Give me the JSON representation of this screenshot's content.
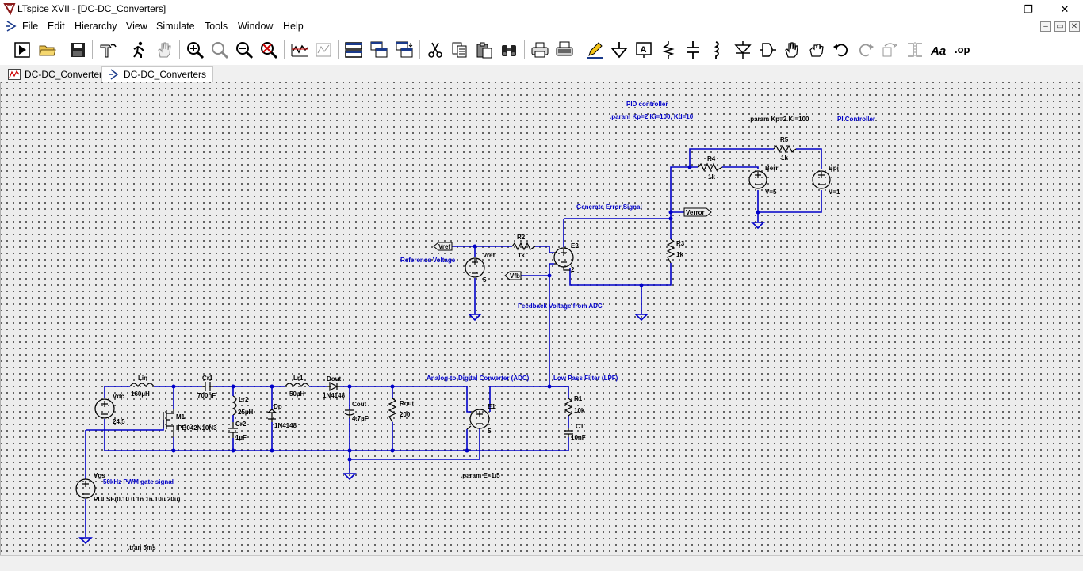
{
  "window": {
    "title": "LTspice XVII - [DC-DC_Converters]",
    "minimize": "—",
    "maximize": "❐",
    "close": "✕"
  },
  "menu": {
    "items": [
      "File",
      "Edit",
      "Hierarchy",
      "View",
      "Simulate",
      "Tools",
      "Window",
      "Help"
    ],
    "mdi_minimize": "–",
    "mdi_restore": "▭",
    "mdi_close": "✕"
  },
  "toolbar": {
    "button_names": [
      "run",
      "open",
      "save",
      "hammer",
      "halt",
      "pan",
      "zoom-in",
      "zoom-full",
      "zoom-out",
      "zoom-cancel",
      "autorange",
      "waveform-plot",
      "tile-horizontal",
      "cascade",
      "tile-vertical",
      "cut",
      "copy",
      "paste",
      "find",
      "print-setup",
      "print",
      "wire",
      "ground",
      "label-net",
      "resistor",
      "capacitor",
      "inductor",
      "diode",
      "component",
      "move",
      "drag",
      "undo",
      "redo",
      "rotate",
      "mirror",
      "text",
      "spice-directive"
    ],
    "spice_directive_glyph": ".op",
    "text_glyph": "Aa"
  },
  "tabs": [
    {
      "label": "DC-DC_Converters",
      "type": "waveform"
    },
    {
      "label": "DC-DC_Converters",
      "type": "schematic"
    }
  ],
  "schematic": {
    "labels": {
      "pid_title": "PID controller",
      "pid_param": ".param Kp=2 Ki=100, Kd=10",
      "pi_param": ".param Kp=2 Ki=100",
      "pi_title": "PI Controller",
      "gen_error": "Generate Error Signal",
      "ref_voltage": "Reference Voltage",
      "fb_voltage": "Feedback Voltage from ADC",
      "adc": "Analog-to-Digital Converter (ADC)",
      "lpf": "Low Pass Filter (LPF)",
      "pwm_gate": "50kHz PWM gate signal",
      "param_e": ".param E=1/5",
      "tran": ".tran 5ms"
    },
    "nets": {
      "verror": "Verror",
      "vref": "Vref",
      "vfb": "Vfb"
    },
    "components": {
      "r5": {
        "name": "R5",
        "value": "1k"
      },
      "r4": {
        "name": "R4",
        "value": "1k"
      },
      "berr": {
        "name": "Berr",
        "value": "V=5"
      },
      "bpi": {
        "name": "Bpi",
        "value": "V=1"
      },
      "r3": {
        "name": "R3",
        "value": "1k"
      },
      "r2": {
        "name": "R2",
        "value": "1k"
      },
      "e2": {
        "name": "E2",
        "value": "2"
      },
      "vref": {
        "name": "Vref",
        "value": "5"
      },
      "lin": {
        "name": "Lin",
        "value": "160µH"
      },
      "cr1": {
        "name": "Cr1",
        "value": "700nF"
      },
      "lr2": {
        "name": "Lr2",
        "value": "25µH"
      },
      "cr2": {
        "name": "Cr2",
        "value": "1µF"
      },
      "lr1": {
        "name": "Lr1",
        "value": "50µH"
      },
      "dout": {
        "name": "Dout",
        "value": "1N4148"
      },
      "dp": {
        "name": "Dp",
        "value": "1N4148"
      },
      "cout": {
        "name": "Cout",
        "value": "4.7µF"
      },
      "rout": {
        "name": "Rout",
        "value": "200"
      },
      "e1": {
        "name": "E1",
        "value": "5"
      },
      "r1": {
        "name": "R1",
        "value": "10k"
      },
      "c1": {
        "name": "C1",
        "value": "10nF"
      },
      "vdc": {
        "name": "Vdc",
        "value": "24.5"
      },
      "m1": {
        "name": "M1",
        "value": "IPB042N10N3"
      },
      "vgs": {
        "name": "Vgs",
        "value": "PULSE(0 10 0 1n 1n 10u 20u)"
      }
    }
  },
  "colors": {
    "wire": "#0000c8",
    "component": "#000000",
    "comment": "#0000c8",
    "canvas": "#ececec"
  }
}
